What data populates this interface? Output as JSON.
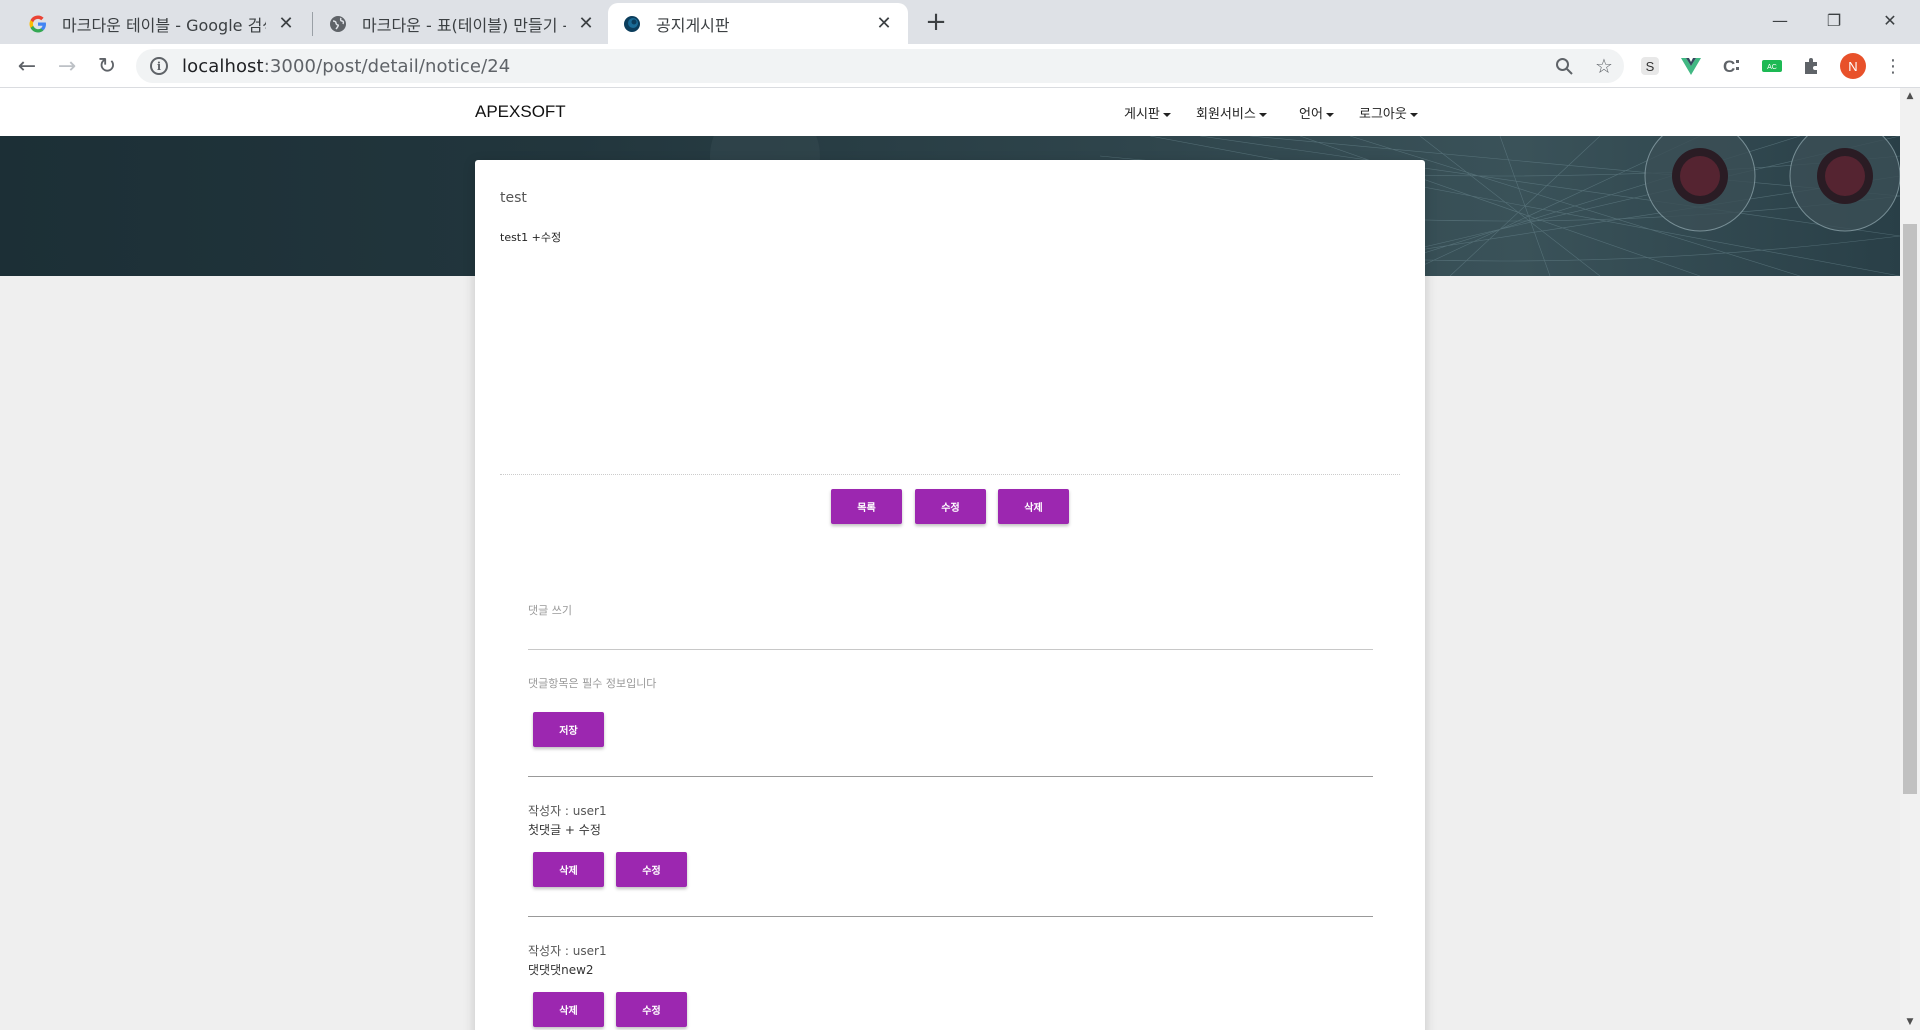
{
  "browser": {
    "tabs": [
      {
        "title": "마크다운 테이블 - Google 검색",
        "icon": "google-icon"
      },
      {
        "title": "마크다운 - 표(테이블) 만들기 - ",
        "icon": "globe-icon"
      },
      {
        "title": "공지게시판",
        "icon": "site-icon"
      }
    ],
    "url_host": "localhost",
    "url_rest": ":3000/post/detail/notice/24",
    "profile_initial": "N",
    "extensions": [
      "s-extension-icon",
      "vue-devtools-icon",
      "c-extension-icon",
      "ac-extension-icon",
      "puzzle-icon"
    ]
  },
  "site": {
    "brand": "APEXSOFT",
    "menu": [
      "게시판",
      "회원서비스",
      "언어",
      "로그아웃"
    ]
  },
  "post": {
    "title": "test",
    "body": "test1 +수정",
    "buttons": {
      "list": "목록",
      "edit": "수정",
      "delete": "삭제"
    }
  },
  "comment_form": {
    "label": "댓글 쓰기",
    "value": "",
    "help": "댓글항목은 필수 정보입니다",
    "save": "저장"
  },
  "comments": [
    {
      "author": "작성자 : user1",
      "text": "첫댓글 + 수정",
      "delete": "삭제",
      "edit": "수정"
    },
    {
      "author": "작성자 : user1",
      "text": "댓댓댓new2",
      "delete": "삭제",
      "edit": "수정"
    }
  ],
  "colors": {
    "accent": "#9c27b0"
  }
}
